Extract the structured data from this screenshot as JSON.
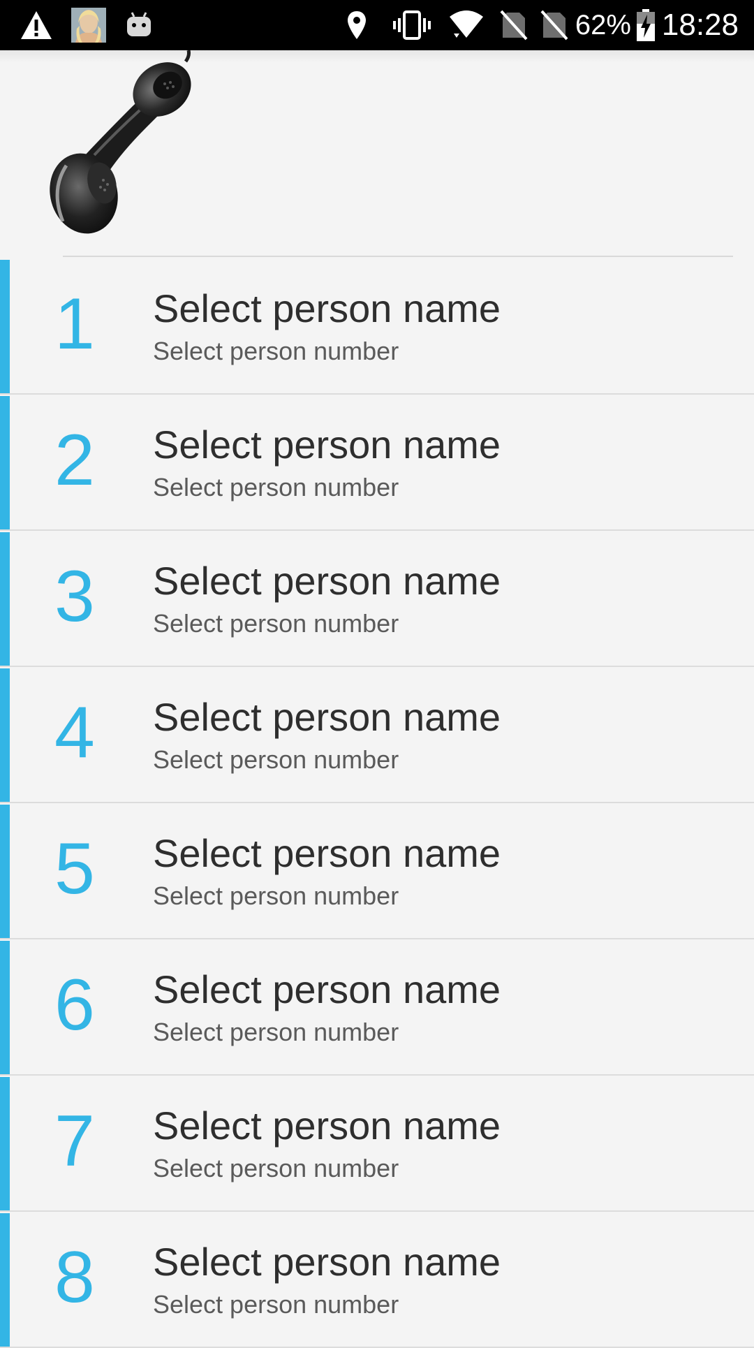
{
  "status_bar": {
    "icons_left": [
      "warning-icon",
      "avatar-thumbnail",
      "android-icon"
    ],
    "icons_right": [
      "location-icon",
      "vibrate-icon",
      "wifi-icon",
      "no-sim-icon",
      "no-sim-icon",
      "battery-charging-icon"
    ],
    "battery_percent": "62%",
    "time": "18:28"
  },
  "header": {
    "graphic": "telephone-handset"
  },
  "contacts": [
    {
      "index": "1",
      "name": "Select person name",
      "number": "Select person number"
    },
    {
      "index": "2",
      "name": "Select person name",
      "number": "Select person number"
    },
    {
      "index": "3",
      "name": "Select person name",
      "number": "Select person number"
    },
    {
      "index": "4",
      "name": "Select person name",
      "number": "Select person number"
    },
    {
      "index": "5",
      "name": "Select person name",
      "number": "Select person number"
    },
    {
      "index": "6",
      "name": "Select person name",
      "number": "Select person number"
    },
    {
      "index": "7",
      "name": "Select person name",
      "number": "Select person number"
    },
    {
      "index": "8",
      "name": "Select person name",
      "number": "Select person number"
    }
  ],
  "colors": {
    "accent": "#33b5e5",
    "background": "#f4f4f4",
    "status_bar": "#000000",
    "name_text": "#2e2e2e",
    "number_text": "#5a5a5a"
  }
}
